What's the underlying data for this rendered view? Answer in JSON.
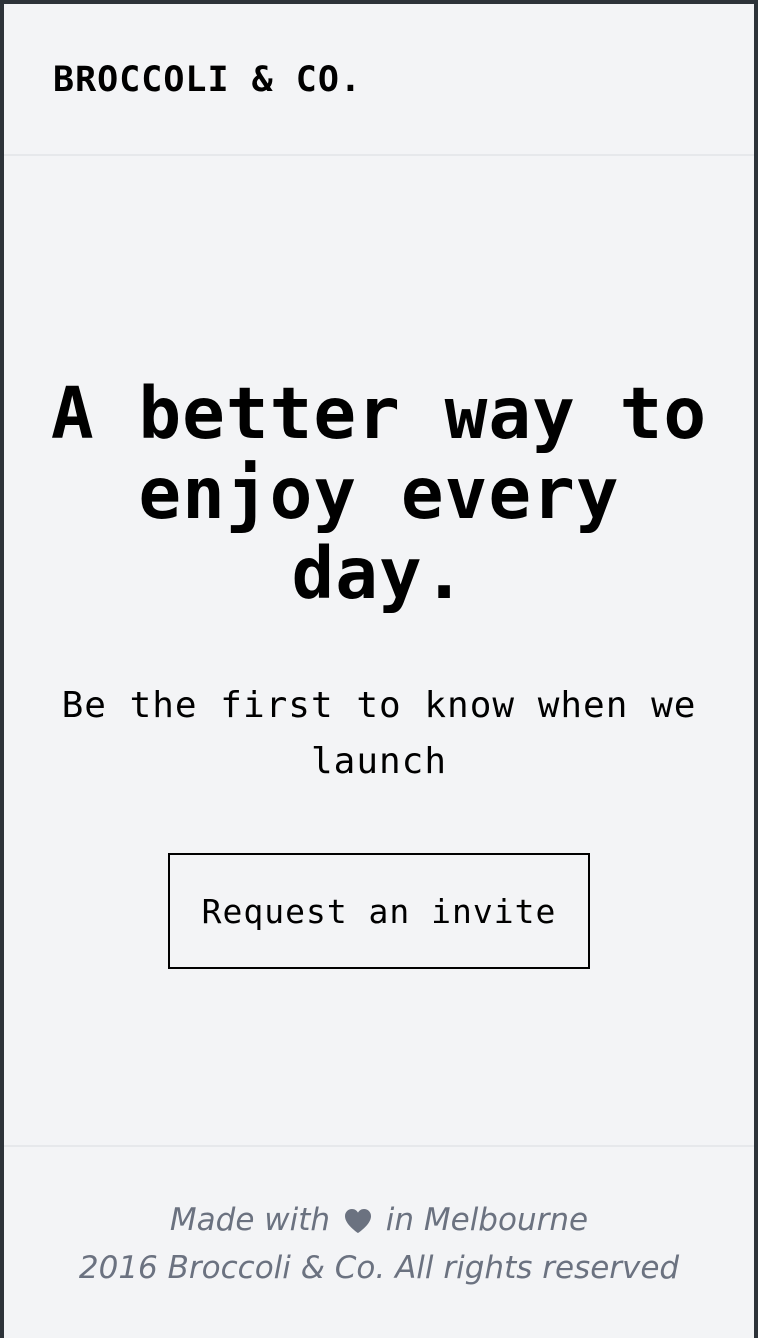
{
  "header": {
    "brand": "BROCCOLI & CO."
  },
  "hero": {
    "headline": "A better way to enjoy every day.",
    "subheadline": "Be the first to know when we launch",
    "cta_label": "Request an invite"
  },
  "footer": {
    "made_with_prefix": "Made with",
    "made_with_icon": "heart-icon",
    "made_with_suffix": "in Melbourne",
    "copyright": "2016 Broccoli & Co. All rights reserved"
  },
  "colors": {
    "background": "#f3f4f6",
    "text": "#000000",
    "footer_text": "#6b7280"
  }
}
